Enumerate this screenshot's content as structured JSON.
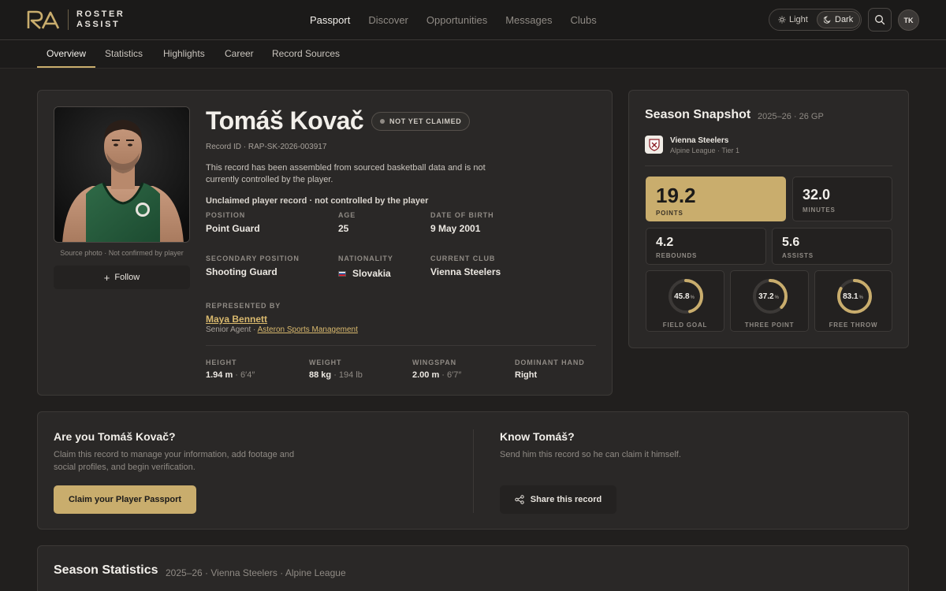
{
  "app": {
    "logo_mark": "RA",
    "logo_line1": "ROSTER",
    "logo_line2": "ASSIST"
  },
  "nav": {
    "items": [
      "Passport",
      "Discover",
      "Opportunities",
      "Messages",
      "Clubs"
    ],
    "active": "Passport"
  },
  "theme": {
    "light_label": "Light",
    "dark_label": "Dark",
    "selected": "Dark"
  },
  "user": {
    "initials": "TK"
  },
  "subnav": {
    "tabs": [
      "Overview",
      "Statistics",
      "Highlights",
      "Career",
      "Record Sources"
    ],
    "active": "Overview"
  },
  "profile": {
    "name": "Tomáš Kovač",
    "badge": "NOT YET CLAIMED",
    "record_id": "Record ID · RAP-SK-2026-003917",
    "description": "This record has been assembled from sourced basketball data and is not currently controlled by the player.",
    "unclaimed_note": "Unclaimed player record · not controlled by the player",
    "photo_caption": "Source photo · Not confirmed by player",
    "follow_label": "Follow",
    "fields": {
      "position": {
        "label": "POSITION",
        "value": "Point Guard"
      },
      "age": {
        "label": "AGE",
        "value": "25"
      },
      "dob": {
        "label": "DATE OF BIRTH",
        "value": "9 May 2001"
      },
      "secondary": {
        "label": "SECONDARY POSITION",
        "value": "Shooting Guard"
      },
      "nationality": {
        "label": "NATIONALITY",
        "value": "Slovakia"
      },
      "club": {
        "label": "CURRENT CLUB",
        "value": "Vienna Steelers"
      }
    },
    "represented": {
      "label": "REPRESENTED BY",
      "agent": "Maya Bennett",
      "role": "Senior Agent · ",
      "agency": "Asteron Sports Management"
    },
    "measurements": {
      "height": {
        "label": "HEIGHT",
        "value": "1.94 m",
        "secondary": " · 6′4″"
      },
      "weight": {
        "label": "WEIGHT",
        "value": "88 kg",
        "secondary": " · 194 lb"
      },
      "wingspan": {
        "label": "WINGSPAN",
        "value": "2.00 m",
        "secondary": " · 6′7″"
      },
      "hand": {
        "label": "DOMINANT HAND",
        "value": "Right"
      }
    }
  },
  "snapshot": {
    "title": "Season Snapshot",
    "subtitle": "2025–26 · 26 GP",
    "team": "Vienna Steelers",
    "league": "Alpine League · Tier 1",
    "stats": {
      "points": {
        "value": "19.2",
        "label": "POINTS"
      },
      "minutes": {
        "value": "32.0",
        "label": "MINUTES"
      },
      "rebounds": {
        "value": "4.2",
        "label": "REBOUNDS"
      },
      "assists": {
        "value": "5.6",
        "label": "ASSISTS"
      }
    },
    "percentages": [
      {
        "value": "45.8",
        "pct": 45.8,
        "label": "FIELD GOAL"
      },
      {
        "value": "37.2",
        "pct": 37.2,
        "label": "THREE POINT"
      },
      {
        "value": "83.1",
        "pct": 83.1,
        "label": "FREE THROW"
      }
    ],
    "pct_unit": "%",
    "accent": "#c9ad6d"
  },
  "claim": {
    "title": "Are you Tomáš Kovač?",
    "text": "Claim this record to manage your information, add footage and social profiles, and begin verification.",
    "button": "Claim your Player Passport",
    "know_title": "Know Tomáš?",
    "know_text": "Send him this record so he can claim it himself.",
    "share_button": "Share this record"
  },
  "season_stats": {
    "title": "Season Statistics",
    "subtitle": "2025–26 · Vienna Steelers · Alpine League"
  }
}
